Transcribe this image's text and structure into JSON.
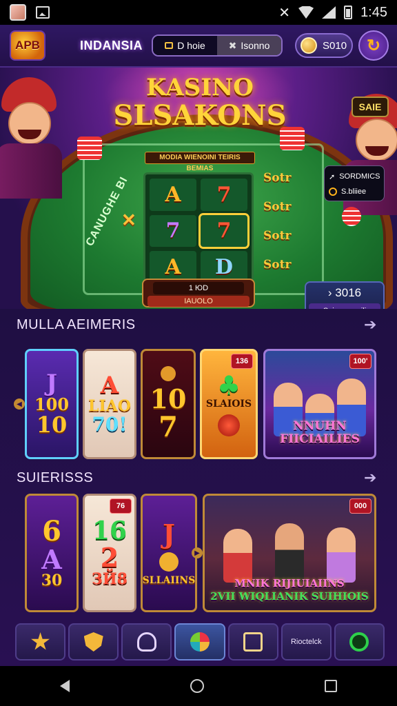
{
  "status_bar": {
    "time": "1:45"
  },
  "header": {
    "logo_text": "APB",
    "region": "INDANSIA",
    "segment": {
      "left": "D hoie",
      "right": "Isonno"
    },
    "balance": "S010"
  },
  "banner": {
    "title_line1": "KASINO",
    "title_line2": "SLSAKONS",
    "subtitle": "MODIA WIENOINI TEIRIS BEMIAS",
    "sale_badge": "SAIE",
    "felt_text": "CANUGHE BI",
    "reel_symbols": [
      "A",
      "7",
      "7",
      "7",
      "A",
      "D"
    ],
    "sort_labels": [
      "Sotr",
      "Sotr",
      "Sotr",
      "Sotr"
    ],
    "side_menu": [
      "SORDMICS",
      "S.bliiee"
    ],
    "counter_top": "1 ЮD",
    "counter_bottom": "IAUOLO",
    "score": "3016",
    "score_label": "Soiemeoceili"
  },
  "section1": {
    "title": "MULLA AEIMERIS",
    "tiles": [
      {
        "l1": "J",
        "l2": "100",
        "l3": "10"
      },
      {
        "l1": "A",
        "l2": "LIAO",
        "l3": "70!"
      },
      {
        "l1": "10",
        "l2": "7"
      },
      {
        "l1": "SLAIOIS",
        "badge": "136"
      },
      {
        "l1": "NNUHN",
        "l2": "FIICIAILIES",
        "badge": "100'"
      }
    ]
  },
  "section2": {
    "title": "SUIERISSS",
    "tiles": [
      {
        "l1": "6",
        "l2": "A",
        "l3": "30"
      },
      {
        "l1": "16",
        "l2": "2",
        "l3": "ЗЙ8",
        "badge": "76"
      },
      {
        "l1": "J",
        "l2": "SLLAIINS"
      },
      {
        "l1": "MNIK",
        "l2": "RIJIUIAIINS",
        "l3": "2VII WIQLIANIK SUIHIOIS",
        "badge": "000"
      }
    ]
  },
  "bottom_nav": {
    "items": [
      "",
      "",
      "",
      "",
      "",
      "Rioctelck",
      ""
    ]
  }
}
